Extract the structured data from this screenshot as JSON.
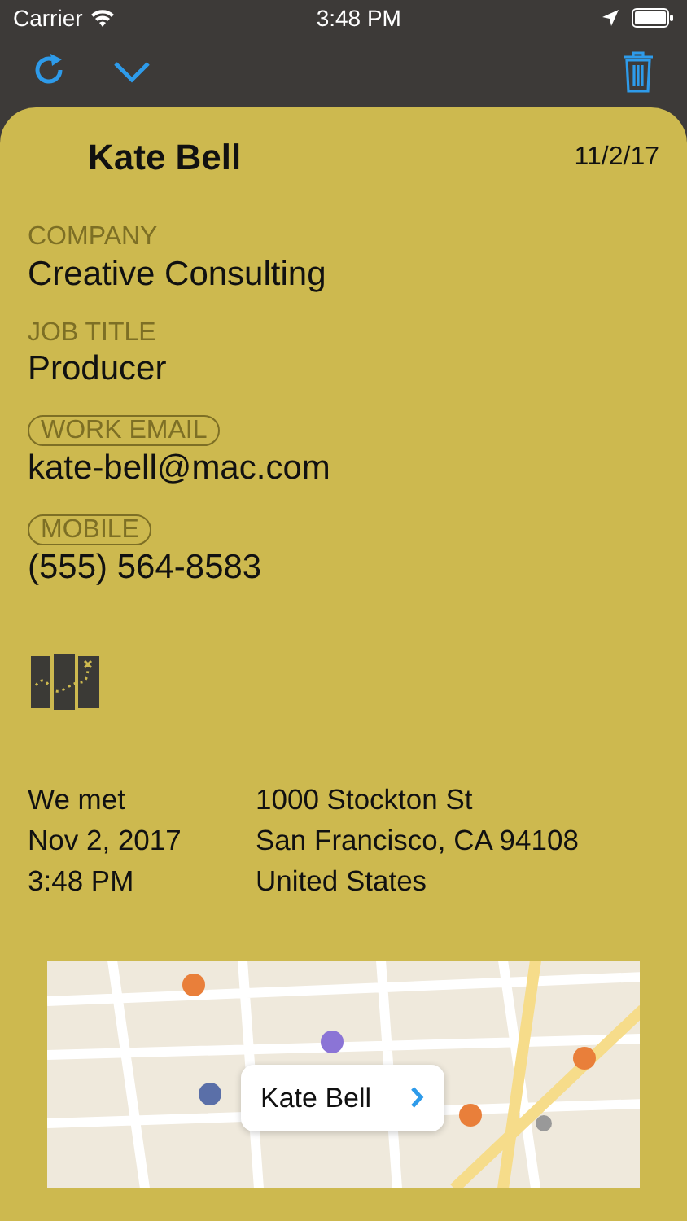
{
  "status_bar": {
    "carrier": "Carrier",
    "time": "3:48 PM"
  },
  "contact": {
    "name": "Kate Bell",
    "date": "11/2/17"
  },
  "fields": [
    {
      "label": "COMPANY",
      "value": "Creative Consulting",
      "outlined": false
    },
    {
      "label": "JOB TITLE",
      "value": "Producer",
      "outlined": false
    },
    {
      "label": "WORK EMAIL",
      "value": "kate-bell@mac.com",
      "outlined": true
    },
    {
      "label": "MOBILE",
      "value": "(555) 564-8583",
      "outlined": true
    }
  ],
  "met": [
    "We met",
    "Nov 2, 2017",
    "3:48 PM"
  ],
  "address": [
    "1000 Stockton St",
    "San Francisco, CA  94108",
    "United States"
  ],
  "map": {
    "kind": "picture",
    "callout": {
      "title": "Kate Bell"
    }
  }
}
